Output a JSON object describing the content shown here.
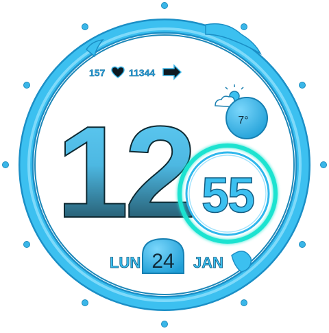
{
  "watch": {
    "stats": {
      "heart_rate": "157",
      "steps": "11344"
    },
    "time": {
      "hour": "12",
      "minute": "55"
    },
    "weather": {
      "temperature": "7°"
    },
    "date": {
      "weekday": "LUN",
      "day": "24",
      "month": "JAN"
    }
  },
  "colors": {
    "accent": "#2fb7ec",
    "accent_light": "#7fd9fb",
    "ring_glow": "#1fe3d0",
    "text_blue": "#2a9fdb",
    "hour_top": "#5cc8f2",
    "hour_bottom": "#173a45"
  },
  "icons": [
    "heart-icon",
    "steps-arrow-icon",
    "weather-cloud-sun-icon"
  ]
}
